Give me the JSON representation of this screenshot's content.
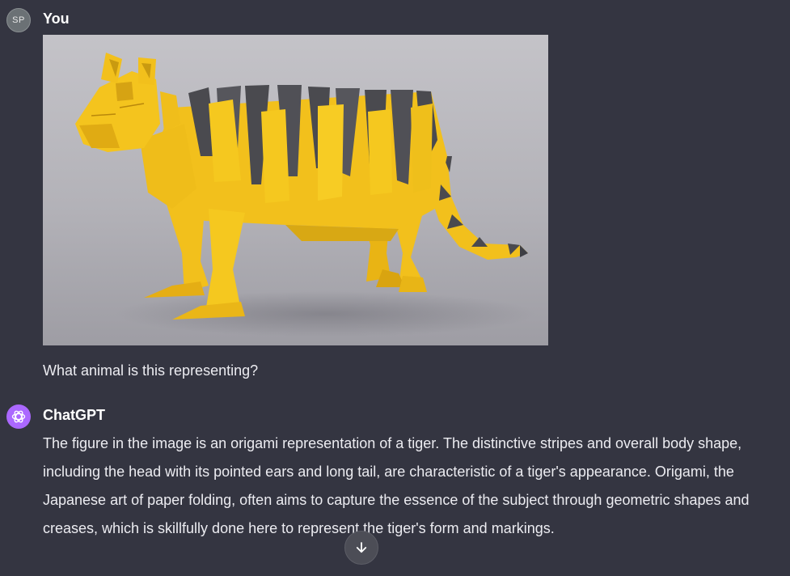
{
  "user_message": {
    "avatar_initials": "SP",
    "author": "You",
    "image_icon": "origami-tiger-photo",
    "text": "What animal is this representing?"
  },
  "assistant_message": {
    "avatar_icon": "openai-logo-icon",
    "author": "ChatGPT",
    "text": "The figure in the image is an origami representation of a tiger. The distinctive stripes and overall body shape, including the head with its pointed ears and long tail, are characteristic of a tiger's appearance. Origami, the Japanese art of paper folding, often aims to capture the essence of the subject through geometric shapes and creases, which is skillfully done here to represent the tiger's form and markings."
  },
  "scroll_button": {
    "icon": "arrow-down-icon"
  },
  "colors": {
    "background": "#343541",
    "assistant_avatar": "#ab68ff",
    "user_avatar": "#6b7175",
    "tiger_yellow": "#f2c01c",
    "tiger_stripes": "#4a4a4f"
  }
}
